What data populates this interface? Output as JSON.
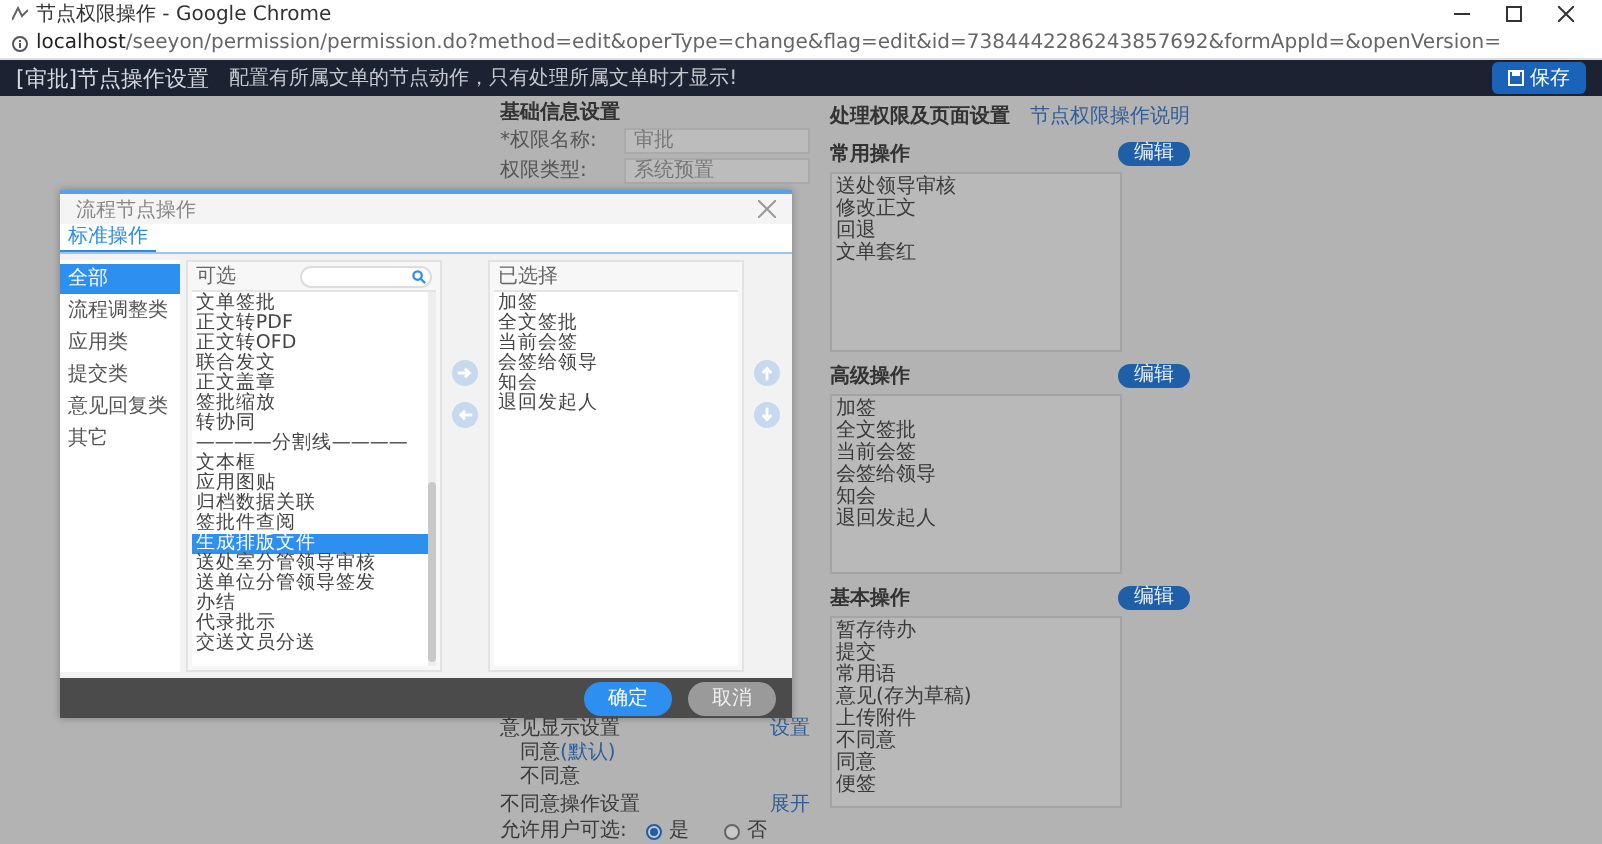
{
  "window": {
    "title": "节点权限操作 - Google Chrome"
  },
  "address_bar": {
    "host": "localhost",
    "path": "/seeyon/permission/permission.do?method=edit&operType=change&flag=edit&id=7384442286243857692&formAppId=&openVersion="
  },
  "header": {
    "title": "[审批]节点操作设置",
    "hint": "配置有所属文单的节点动作，只有处理所属文单时才显示!",
    "save_button": "保存"
  },
  "basic_info": {
    "title": "基础信息设置",
    "fields": [
      {
        "label": "*权限名称:",
        "value": "审批"
      },
      {
        "label": "权限类型:",
        "value": "系统预置"
      }
    ]
  },
  "opinion_display": {
    "label": "意见显示设置",
    "link": "设置",
    "options": [
      {
        "text": "同意",
        "note": "(默认)"
      },
      {
        "text": "不同意"
      }
    ]
  },
  "disagree_settings": {
    "label": "不同意操作设置",
    "link": "展开",
    "allow_label": "允许用户可选:",
    "radios": [
      {
        "label": "是",
        "selected": true
      },
      {
        "label": "否",
        "selected": false
      }
    ]
  },
  "permissions": {
    "title": "处理权限及页面设置",
    "help_link": "节点权限操作说明",
    "groups": [
      {
        "title": "常用操作",
        "button": "编辑",
        "items": [
          "送处领导审核",
          "修改正文",
          "回退",
          "文单套红"
        ]
      },
      {
        "title": "高级操作",
        "button": "编辑",
        "items": [
          "加签",
          "全文签批",
          "当前会签",
          "会签给领导",
          "知会",
          "退回发起人"
        ]
      },
      {
        "title": "基本操作",
        "button": "编辑",
        "items": [
          "暂存待办",
          "提交",
          "常用语",
          "意见(存为草稿)",
          "上传附件",
          "不同意",
          "同意",
          "便签"
        ]
      }
    ]
  },
  "dialog": {
    "title": "流程节点操作",
    "tabs": [
      {
        "label": "标准操作",
        "selected": true
      }
    ],
    "categories": [
      {
        "label": "全部",
        "selected": true
      },
      {
        "label": "流程调整类",
        "selected": false
      },
      {
        "label": "应用类",
        "selected": false
      },
      {
        "label": "提交类",
        "selected": false
      },
      {
        "label": "意见回复类",
        "selected": false
      },
      {
        "label": "其它",
        "selected": false
      }
    ],
    "available": {
      "title": "可选",
      "items": [
        {
          "label": "文单签批",
          "selected": false
        },
        {
          "label": "正文转PDF",
          "selected": false
        },
        {
          "label": "正文转OFD",
          "selected": false
        },
        {
          "label": "联合发文",
          "selected": false
        },
        {
          "label": "正文盖章",
          "selected": false
        },
        {
          "label": "签批缩放",
          "selected": false
        },
        {
          "label": "转协同",
          "selected": false
        },
        {
          "label": "————分割线————",
          "selected": false
        },
        {
          "label": "文本框",
          "selected": false
        },
        {
          "label": "应用图贴",
          "selected": false
        },
        {
          "label": "归档数据关联",
          "selected": false
        },
        {
          "label": "签批件查阅",
          "selected": false
        },
        {
          "label": "生成排版文件",
          "selected": true
        },
        {
          "label": "送处室分管领导审核",
          "selected": false
        },
        {
          "label": "送单位分管领导签发",
          "selected": false
        },
        {
          "label": "办结",
          "selected": false
        },
        {
          "label": "代录批示",
          "selected": false
        },
        {
          "label": "交送文员分送",
          "selected": false
        }
      ]
    },
    "chosen": {
      "title": "已选择",
      "items": [
        "加签",
        "全文签批",
        "当前会签",
        "会签给领导",
        "知会",
        "退回发起人"
      ]
    },
    "buttons": [
      {
        "label": "确定",
        "kind": "primary"
      },
      {
        "label": "取消",
        "kind": "secondary"
      }
    ]
  }
}
